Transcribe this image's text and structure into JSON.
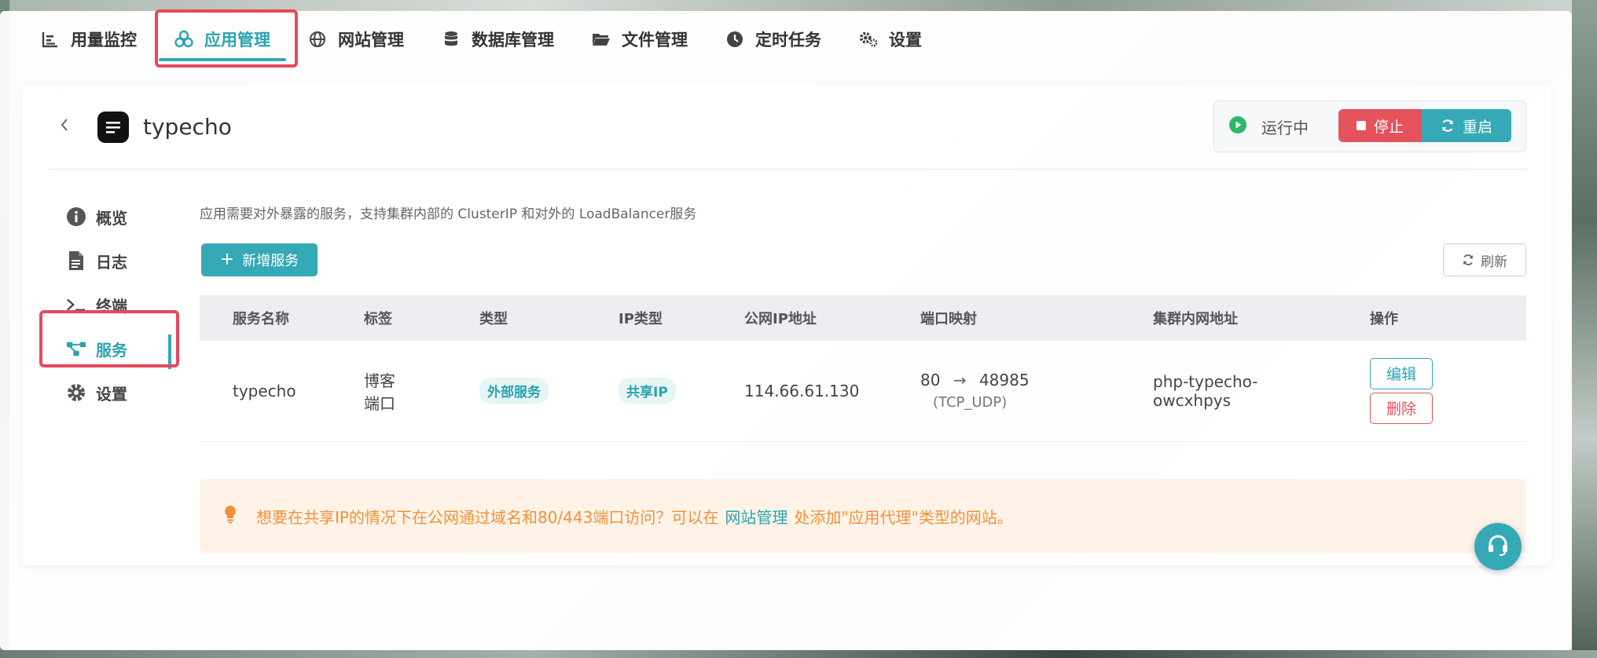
{
  "nav": {
    "items": [
      {
        "label": "用量监控",
        "icon": "chart-icon"
      },
      {
        "label": "应用管理",
        "icon": "apps-icon",
        "active": true
      },
      {
        "label": "网站管理",
        "icon": "globe-icon"
      },
      {
        "label": "数据库管理",
        "icon": "database-icon"
      },
      {
        "label": "文件管理",
        "icon": "folder-icon"
      },
      {
        "label": "定时任务",
        "icon": "clock-icon"
      },
      {
        "label": "设置",
        "icon": "gears-icon"
      }
    ]
  },
  "app": {
    "title": "typecho",
    "status": "运行中",
    "stop_label": "停止",
    "restart_label": "重启"
  },
  "side": {
    "items": [
      {
        "label": "概览",
        "icon": "info-icon"
      },
      {
        "label": "日志",
        "icon": "file-icon"
      },
      {
        "label": "终端",
        "icon": "terminal-icon"
      },
      {
        "label": "服务",
        "icon": "share-nodes-icon",
        "active": true
      },
      {
        "label": "设置",
        "icon": "gear-icon"
      }
    ]
  },
  "content": {
    "description": "应用需要对外暴露的服务，支持集群内部的 ClusterIP 和对外的 LoadBalancer服务",
    "add_label": "新增服务",
    "refresh_label": "刷新"
  },
  "table": {
    "headers": [
      "服务名称",
      "标签",
      "类型",
      "IP类型",
      "公网IP地址",
      "端口映射",
      "集群内网地址",
      "操作"
    ],
    "rows": [
      {
        "name": "typecho",
        "label_line1": "博客",
        "label_line2": "端口",
        "type": "外部服务",
        "ip_type": "共享IP",
        "public_ip": "114.66.61.130",
        "port_from": "80",
        "port_arrow": "→",
        "port_to": "48985",
        "protocol": "(TCP_UDP)",
        "cluster_addr_line1": "php-typecho-",
        "cluster_addr_line2": "owcxhpys",
        "edit_label": "编辑",
        "delete_label": "删除"
      }
    ]
  },
  "tip": {
    "text_before": "想要在共享IP的情况下在公网通过域名和80/443端口访问？可以在",
    "link": "网站管理",
    "text_after": "处添加\"应用代理\"类型的网站。"
  },
  "colors": {
    "accent": "#35a9b6",
    "danger": "#e5525c",
    "highlight": "#e8475d",
    "tip_text": "#f0913a"
  }
}
